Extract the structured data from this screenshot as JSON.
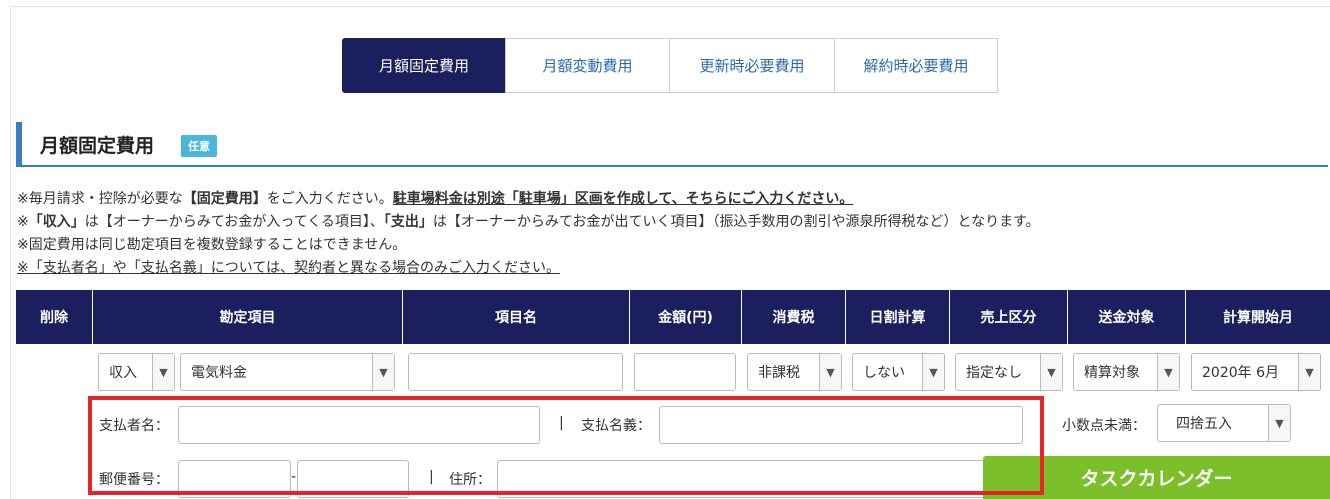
{
  "tabs": [
    {
      "label": "月額固定費用",
      "active": true
    },
    {
      "label": "月額変動費用",
      "active": false
    },
    {
      "label": "更新時必要費用",
      "active": false
    },
    {
      "label": "解約時必要費用",
      "active": false
    }
  ],
  "section": {
    "title": "月額固定費用",
    "badge": "任意"
  },
  "notes": {
    "line1_a": "※毎月請求・控除が必要な",
    "line1_b": "【固定費用】",
    "line1_c": "をご入力ください。",
    "line1_d": "駐車場料金は別途「駐車場」区画を作成して、そちらにご入力ください。",
    "line2_a": "※",
    "line2_b": "「収入」",
    "line2_c": "は【オーナーからみてお金が入ってくる項目】、",
    "line2_d": "「支出」",
    "line2_e": "は【オーナーからみてお金が出ていく項目】（振込手数用の割引や源泉所得税など）となります。",
    "line3": "※固定費用は同じ勘定項目を複数登録することはできません。",
    "line4": "※「支払者名」や「支払名義」については、契約者と異なる場合のみご入力ください。"
  },
  "table": {
    "headers": [
      "削除",
      "勘定項目",
      "項目名",
      "金額(円)",
      "消費税",
      "日割計算",
      "売上区分",
      "送金対象",
      "計算開始月"
    ],
    "row": {
      "type": "収入",
      "account": "電気料金",
      "item_name": "",
      "amount": "",
      "tax": "非課税",
      "prorate": "しない",
      "sales_class": "指定なし",
      "transfer": "精算対象",
      "start_month": "2020年 6月"
    },
    "payer_label": "支払者名：",
    "payer_name_label": "支払名義：",
    "separator": "|",
    "decimal_label": "小数点未満：",
    "decimal_value": "四捨五入",
    "postal_label": "郵便番号：",
    "postal_dash": "-",
    "address_label": "住所："
  },
  "task_button": "タスクカレンダー",
  "colors": {
    "navy": "#1c1f5e",
    "accent": "#3a7fc1",
    "highlight": "#e8242b",
    "green": "#7bbf2a"
  }
}
